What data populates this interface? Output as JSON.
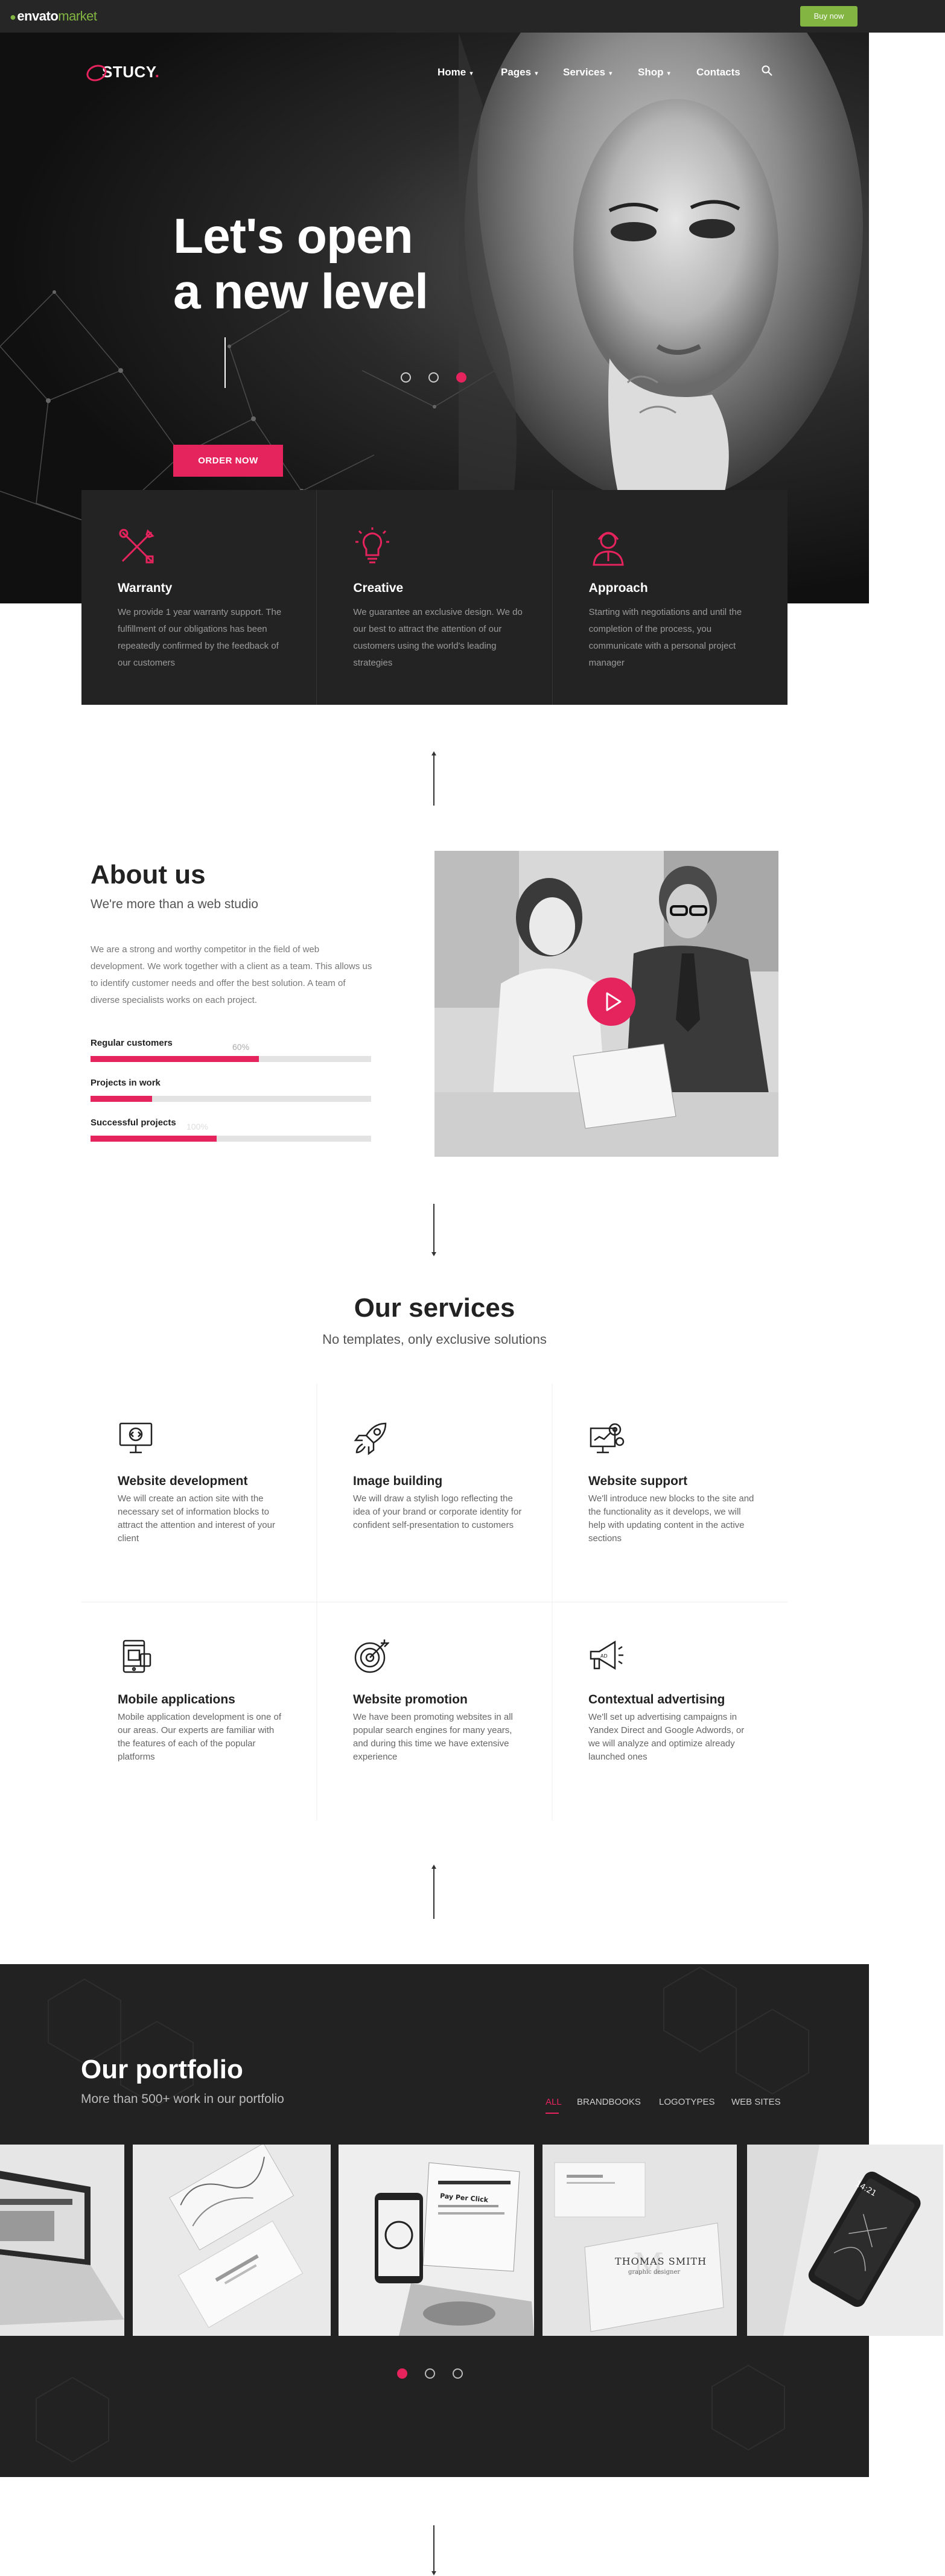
{
  "envato": {
    "logo_word": "envato",
    "logo_market": "market",
    "buy_label": "Buy now"
  },
  "brand": {
    "name": "STUCY",
    "accent": "#e5235d"
  },
  "nav": [
    {
      "label": "Home",
      "chevron": "▾"
    },
    {
      "label": "Pages",
      "chevron": "▾"
    },
    {
      "label": "Services",
      "chevron": "▾"
    },
    {
      "label": "Shop",
      "chevron": "▾"
    },
    {
      "label": "Contacts",
      "chevron": ""
    }
  ],
  "hero": {
    "title_line1": "Let's open",
    "title_line2": "a new level",
    "cta": "ORDER NOW",
    "slides": 3,
    "active_slide": 3
  },
  "features": [
    {
      "icon": "tools-icon",
      "title": "Warranty",
      "text": "We provide 1 year warranty support. The fulfillment of our obligations has been repeatedly confirmed by the feedback of our customers"
    },
    {
      "icon": "lightbulb-icon",
      "title": "Creative",
      "text": "We guarantee an exclusive design. We do our best to attract the attention of our customers using the world's leading strategies"
    },
    {
      "icon": "manager-icon",
      "title": "Approach",
      "text": "Starting with negotiations and until the completion of the process, you communicate with a personal project manager"
    }
  ],
  "about": {
    "title": "About us",
    "subtitle": "We're more than a web studio",
    "text": "We are a strong and worthy competitor in the field of web development. We work together with a client as a team. This allows us to identify customer needs and offer the best solution. A team of diverse specialists works on each project.",
    "bars": [
      {
        "label": "Regular customers",
        "pct_label": "60%",
        "value": 0.6
      },
      {
        "label": "Projects in work",
        "pct_label": "",
        "value": 0.22
      },
      {
        "label": "Successful projects",
        "pct_label": "100%",
        "value": 0.45
      }
    ]
  },
  "services": {
    "title": "Our services",
    "subtitle": "No templates, only exclusive solutions",
    "items": [
      {
        "icon": "monitor-code-icon",
        "title": "Website development",
        "text": "We will create an action site with the necessary set of information blocks to attract the attention and interest of your client"
      },
      {
        "icon": "rocket-icon",
        "title": "Image building",
        "text": "We will draw a stylish logo reflecting the idea of your brand or corporate identity for confident self-presentation to customers"
      },
      {
        "icon": "support-gears-icon",
        "title": "Website support",
        "text": "We'll introduce new blocks to the site and the functionality as it develops, we will help with updating content in the active sections"
      },
      {
        "icon": "mobile-app-icon",
        "title": "Mobile applications",
        "text": "Mobile application development is one of our areas. Our experts are familiar with the features of each of the popular platforms"
      },
      {
        "icon": "target-icon",
        "title": "Website promotion",
        "text": "We have been promoting websites in all popular search engines for many years, and during this time we have extensive experience"
      },
      {
        "icon": "megaphone-icon",
        "title": "Contextual advertising",
        "text": "We'll set up advertising campaigns in Yandex Direct and Google Adwords, or we will analyze and optimize already launched ones"
      }
    ]
  },
  "portfolio": {
    "title": "Our portfolio",
    "subtitle": "More than 500+ work in our portfolio",
    "filters": [
      "ALL",
      "BRANDBOOKS",
      "LOGOTYPES",
      "WEB SITES"
    ],
    "card_texts": {
      "pay_per_click": "Pay Per Click",
      "card_name": "THOMAS SMITH",
      "card_role": "graphic designer",
      "phone_time": "14:21"
    },
    "slides": 3,
    "active_slide": 1
  }
}
